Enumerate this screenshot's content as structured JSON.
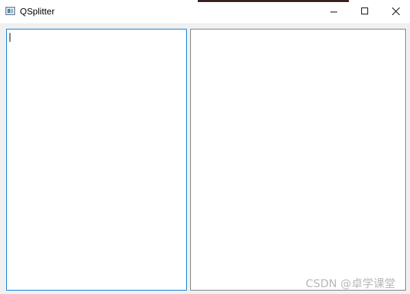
{
  "window": {
    "title": "QSplitter"
  },
  "watermark": {
    "text": "CSDN @卓学课堂"
  },
  "colors": {
    "focus_border": "#0078d7",
    "pane_border": "#7a7a7a",
    "client_background": "#f0f0f0"
  }
}
